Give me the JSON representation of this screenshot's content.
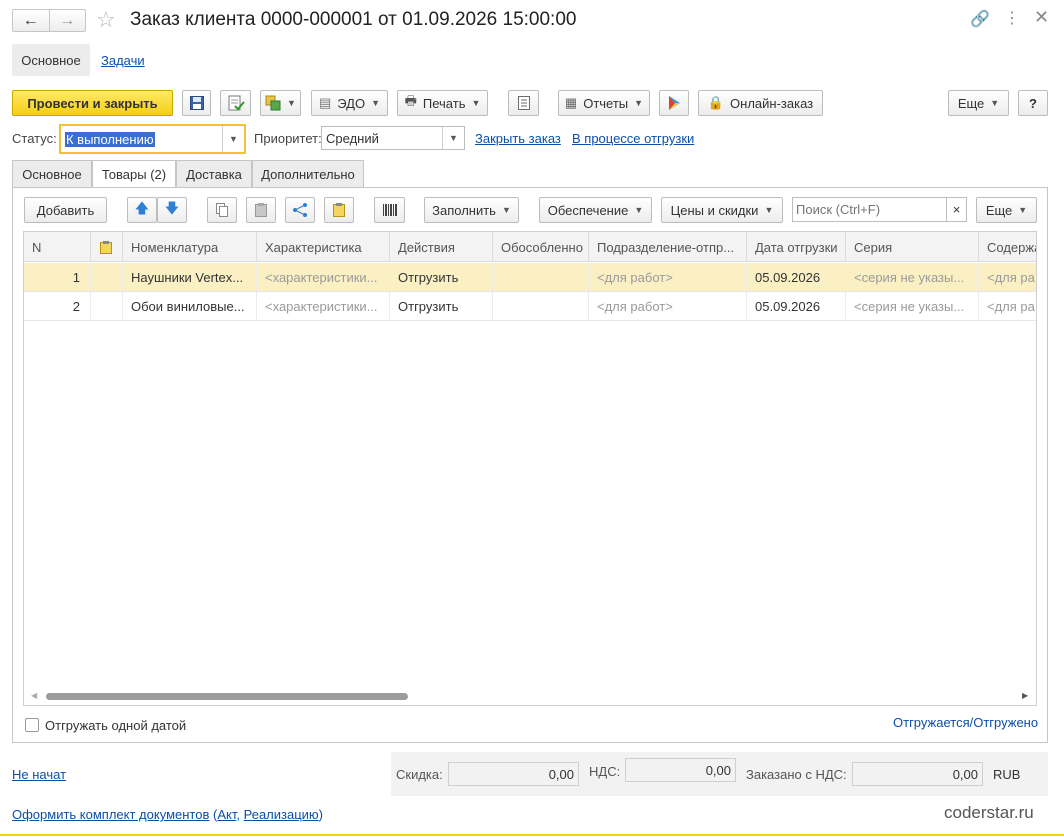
{
  "header": {
    "title": "Заказ клиента 0000-000001 от 01.09.2026 15:00:00"
  },
  "sections": [
    "Основное",
    "Задачи"
  ],
  "toolbar": {
    "post_close": "Провести и закрыть",
    "edo": "ЭДО",
    "print": "Печать",
    "reports": "Отчеты",
    "online_order": "Онлайн-заказ",
    "more": "Еще",
    "help": "?"
  },
  "status": {
    "label": "Статус:",
    "value": "К выполнению",
    "priority_label": "Приоритет:",
    "priority_value": "Средний",
    "close_order": "Закрыть заказ",
    "shipping_process": "В процессе отгрузки"
  },
  "tabs": [
    {
      "label": "Основное"
    },
    {
      "label": "Товары (2)"
    },
    {
      "label": "Доставка"
    },
    {
      "label": "Дополнительно"
    }
  ],
  "table_toolbar": {
    "add": "Добавить",
    "fill": "Заполнить",
    "supply": "Обеспечение",
    "prices": "Цены и скидки",
    "search_placeholder": "Поиск (Ctrl+F)",
    "clear": "×",
    "more": "Еще"
  },
  "table": {
    "columns": [
      "N",
      "",
      "Номенклатура",
      "Характеристика",
      "Действия",
      "Обособленно",
      "Подразделение-отпр...",
      "Дата отгрузки",
      "Серия",
      "Содержа"
    ],
    "rows": [
      {
        "n": "1",
        "item": "Наушники Vertex...",
        "char": "<характеристики...",
        "action": "Отгрузить",
        "separate": "",
        "dept": "<для работ>",
        "date": "05.09.2026",
        "series": "<серия не указы...",
        "content": "<для ра"
      },
      {
        "n": "2",
        "item": "Обои виниловые...",
        "char": "<характеристики...",
        "action": "Отгрузить",
        "separate": "",
        "dept": "<для работ>",
        "date": "05.09.2026",
        "series": "<серия не указы...",
        "content": "<для ра"
      }
    ]
  },
  "ship_one_date": "Отгружать одной датой",
  "shipped_link": "Отгружается/Отгружено",
  "footer": {
    "not_started": "Не начат",
    "discount_label": "Скидка:",
    "discount_value": "0,00",
    "vat_label": "НДС:",
    "vat_value": "0,00",
    "ordered_label": "Заказано с НДС:",
    "ordered_value": "0,00",
    "currency": "RUB",
    "docs_link": "Оформить комплект документов",
    "open_paren": "(",
    "act": "Акт",
    "comma": ",",
    "realization": "Реализацию",
    "close_paren": ")",
    "watermark": "coderstar.ru"
  }
}
